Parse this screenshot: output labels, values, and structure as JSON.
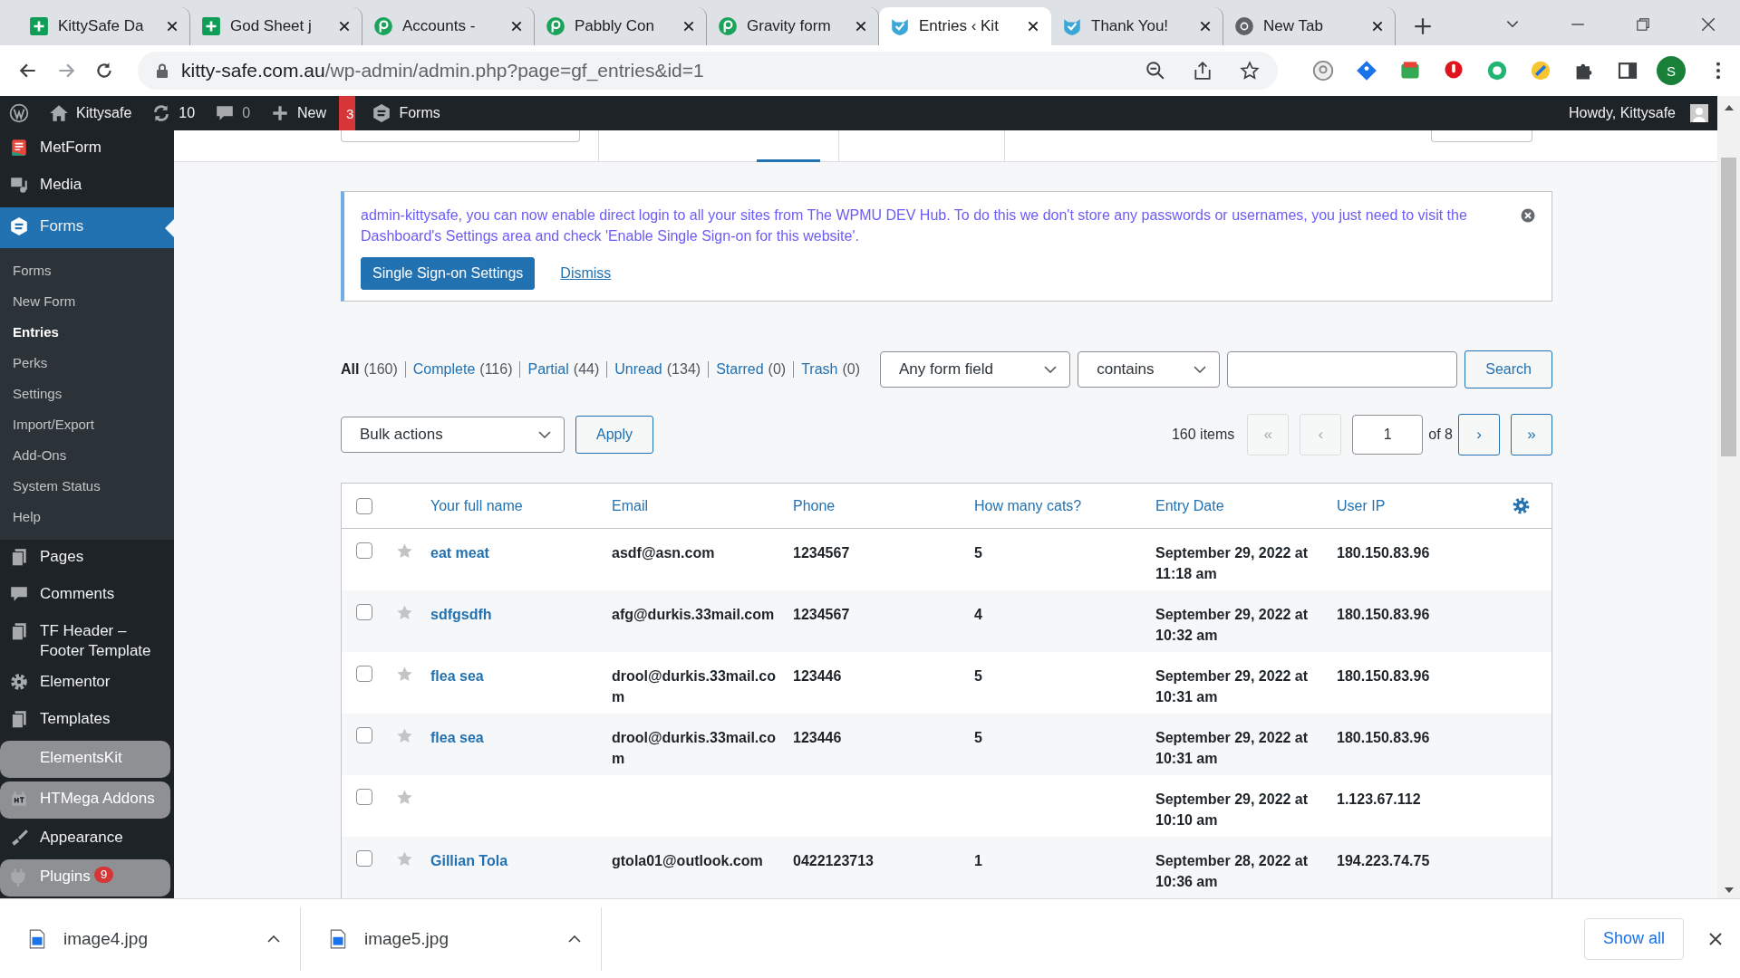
{
  "browser": {
    "tabs": [
      {
        "title": "KittySafe Da",
        "kind": "sheets",
        "selected": false
      },
      {
        "title": "God Sheet j",
        "kind": "sheets",
        "selected": false
      },
      {
        "title": "Accounts -",
        "kind": "pabbly",
        "selected": false
      },
      {
        "title": "Pabbly Con",
        "kind": "pabbly",
        "selected": false
      },
      {
        "title": "Gravity form",
        "kind": "pabbly",
        "selected": false
      },
      {
        "title": "Entries ‹ Kit",
        "kind": "kitty",
        "selected": true
      },
      {
        "title": "Thank You!",
        "kind": "kitty",
        "selected": false
      },
      {
        "title": "New Tab",
        "kind": "chrome",
        "selected": false
      }
    ],
    "address": {
      "host": "kitty-safe.com.au",
      "path": "/wp-admin/admin.php?page=gf_entries&id=1"
    },
    "profile": "S"
  },
  "admin_bar": {
    "site": "Kittysafe",
    "updates": "10",
    "comments": "0",
    "new": "New",
    "badge": "3",
    "forms": "Forms",
    "greeting": "Howdy, Kittysafe"
  },
  "sidebar": {
    "items": [
      {
        "label": "MetForm",
        "kind": "metform",
        "selected": false,
        "dimmed": false
      },
      {
        "label": "Media",
        "kind": "media",
        "selected": false,
        "dimmed": false
      },
      {
        "label": "Forms",
        "kind": "gf",
        "selected": true,
        "dimmed": false,
        "submenu": [
          {
            "label": "Forms",
            "selected": false
          },
          {
            "label": "New Form",
            "selected": false
          },
          {
            "label": "Entries",
            "selected": true
          },
          {
            "label": "Perks",
            "selected": false
          },
          {
            "label": "Settings",
            "selected": false
          },
          {
            "label": "Import/Export",
            "selected": false
          },
          {
            "label": "Add-Ons",
            "selected": false
          },
          {
            "label": "System Status",
            "selected": false
          },
          {
            "label": "Help",
            "selected": false
          }
        ]
      },
      {
        "label": "Pages",
        "kind": "pages",
        "selected": false,
        "dimmed": false
      },
      {
        "label": "Comments",
        "kind": "comments",
        "selected": false,
        "dimmed": false
      },
      {
        "label": "TF Header – Footer Template",
        "kind": "pages",
        "selected": false,
        "dimmed": false
      },
      {
        "label": "Elementor",
        "kind": "gear",
        "selected": false,
        "dimmed": false
      },
      {
        "label": "Templates",
        "kind": "pages",
        "selected": false,
        "dimmed": false
      },
      {
        "label": "ElementsKit",
        "kind": "none",
        "selected": false,
        "dimmed": true
      },
      {
        "label": "HTMega Addons",
        "kind": "ht",
        "selected": false,
        "dimmed": true
      },
      {
        "label": "Appearance",
        "kind": "brush",
        "selected": false,
        "dimmed": false
      },
      {
        "label": "Plugins",
        "kind": "plug",
        "selected": false,
        "dimmed": true,
        "badge": "9"
      }
    ]
  },
  "notice": {
    "text": "admin-kittysafe, you can now enable direct login to all your sites from The WPMU DEV Hub. To do this we don't store any passwords or usernames, you just need to visit the Dashboard's Settings area and check 'Enable Single Sign-on for this website'.",
    "button": "Single Sign-on Settings",
    "link": "Dismiss"
  },
  "filters": [
    {
      "label": "All",
      "count": "(160)",
      "selected": true
    },
    {
      "label": "Complete",
      "count": "(116)",
      "selected": false
    },
    {
      "label": "Partial",
      "count": "(44)",
      "selected": false
    },
    {
      "label": "Unread",
      "count": "(134)",
      "selected": false
    },
    {
      "label": "Starred",
      "count": "(0)",
      "selected": false
    },
    {
      "label": "Trash",
      "count": "(0)",
      "selected": false
    }
  ],
  "search": {
    "field": "Any form field",
    "operator": "contains",
    "button": "Search"
  },
  "bulk": {
    "action": "Bulk actions",
    "button": "Apply"
  },
  "pagination": {
    "total": "160 items",
    "first": "«",
    "prev": "‹",
    "page": "1",
    "of": "of 8",
    "next": "›",
    "last": "»"
  },
  "table": {
    "all_checked": false,
    "columns": [
      "Your full name",
      "Email",
      "Phone",
      "How many cats?",
      "Entry Date",
      "User IP"
    ],
    "rows": [
      {
        "name": "eat meat",
        "email": "asdf@asn.com",
        "phone": "1234567",
        "cats": "5",
        "date": "September 29, 2022 at 11:18 am",
        "ip": "180.150.83.96",
        "checked": false,
        "starred": false
      },
      {
        "name": "sdfgsdfh",
        "email": "afg@durkis.33mail.com",
        "phone": "1234567",
        "cats": "4",
        "date": "September 29, 2022 at 10:32 am",
        "ip": "180.150.83.96",
        "checked": false,
        "starred": false
      },
      {
        "name": "flea sea",
        "email": "drool@durkis.33mail.com",
        "phone": "123446",
        "cats": "5",
        "date": "September 29, 2022 at 10:31 am",
        "ip": "180.150.83.96",
        "checked": false,
        "starred": false
      },
      {
        "name": "flea sea",
        "email": "drool@durkis.33mail.com",
        "phone": "123446",
        "cats": "5",
        "date": "September 29, 2022 at 10:31 am",
        "ip": "180.150.83.96",
        "checked": false,
        "starred": false
      },
      {
        "name": "",
        "email": "",
        "phone": "",
        "cats": "",
        "date": "September 29, 2022 at 10:10 am",
        "ip": "1.123.67.112",
        "checked": false,
        "starred": false
      },
      {
        "name": "Gillian Tola",
        "email": "gtola01@outlook.com",
        "phone": "0422123713",
        "cats": "1",
        "date": "September 28, 2022 at 10:36 am",
        "ip": "194.223.74.75",
        "checked": false,
        "starred": false
      }
    ]
  },
  "downloads": {
    "files": [
      {
        "name": "image4.jpg"
      },
      {
        "name": "image5.jpg"
      }
    ],
    "show_all": "Show all"
  }
}
